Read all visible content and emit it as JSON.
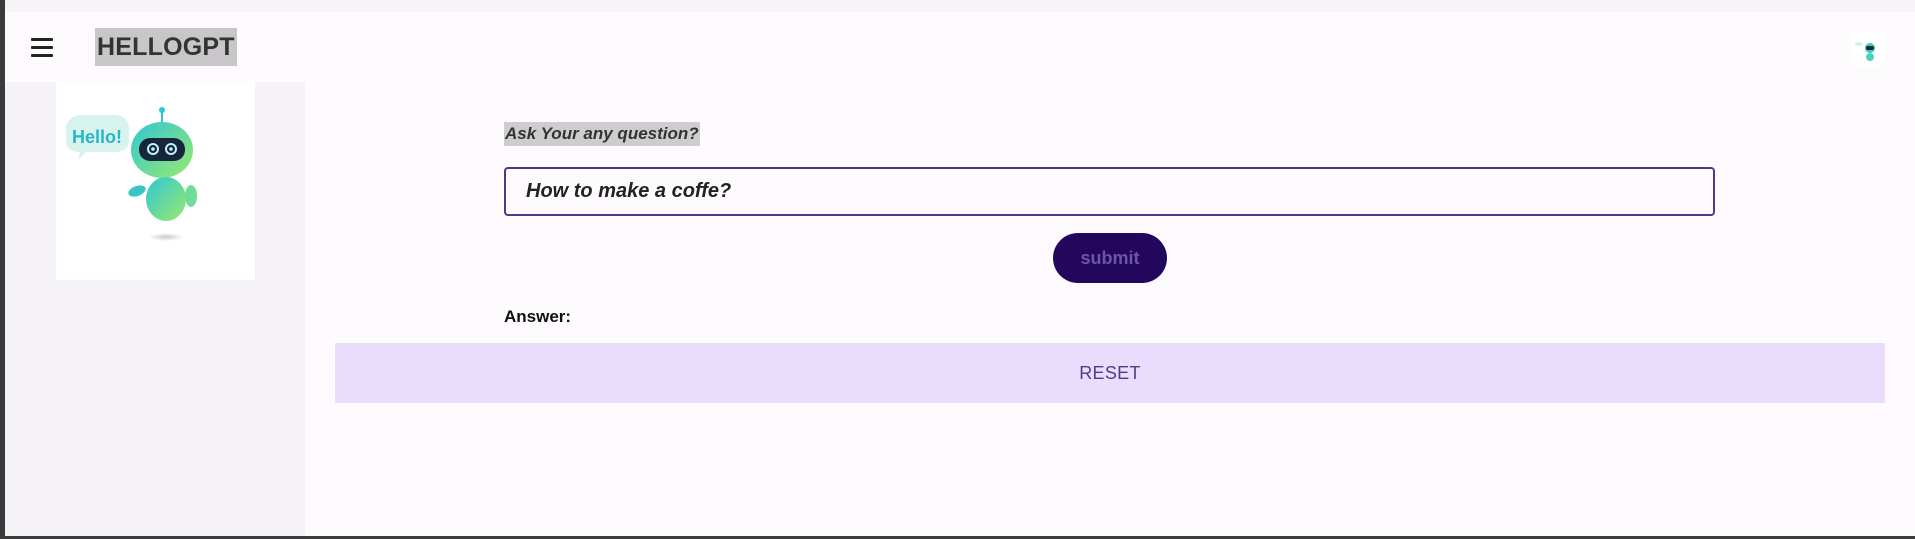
{
  "app": {
    "title": "HELLOGPT",
    "menu_icon": "hamburger-menu-icon",
    "avatar_icon": "robot-avatar-icon"
  },
  "sidebar": {
    "illustration": {
      "name": "hello-robot-illustration",
      "bubble_text": "Hello!"
    }
  },
  "main": {
    "question_label": "Ask Your any question?",
    "question_input": {
      "value": "How to make a coffe?",
      "placeholder": ""
    },
    "submit_label": "submit",
    "answer_label": "Answer:",
    "answer_text": "",
    "reset_label": "RESET"
  },
  "colors": {
    "accent": "#23075c",
    "input_border": "#4b3a8c",
    "reset_bg": "#e9dcfd",
    "reset_text": "#4f3e85",
    "page_bg": "#fefbfe",
    "sidebar_bg": "#f5f2f8"
  }
}
